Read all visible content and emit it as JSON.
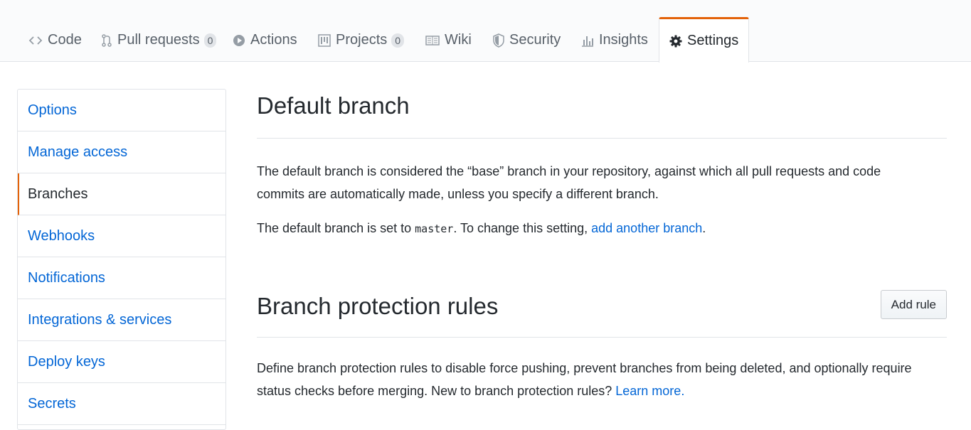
{
  "tabs": [
    {
      "label": "Code",
      "icon": "code-icon"
    },
    {
      "label": "Pull requests",
      "count": "0",
      "icon": "pull-request-icon"
    },
    {
      "label": "Actions",
      "icon": "play-icon"
    },
    {
      "label": "Projects",
      "count": "0",
      "icon": "project-icon"
    },
    {
      "label": "Wiki",
      "icon": "book-icon"
    },
    {
      "label": "Security",
      "icon": "shield-icon"
    },
    {
      "label": "Insights",
      "icon": "graph-icon"
    },
    {
      "label": "Settings",
      "icon": "gear-icon",
      "selected": true
    }
  ],
  "sidebar": {
    "items": [
      {
        "label": "Options"
      },
      {
        "label": "Manage access"
      },
      {
        "label": "Branches",
        "selected": true
      },
      {
        "label": "Webhooks"
      },
      {
        "label": "Notifications"
      },
      {
        "label": "Integrations & services"
      },
      {
        "label": "Deploy keys"
      },
      {
        "label": "Secrets"
      }
    ]
  },
  "default_branch": {
    "title": "Default branch",
    "description": "The default branch is considered the “base” branch in your repository, against which all pull requests and code commits are automatically made, unless you specify a different branch.",
    "set_prefix": "The default branch is set to ",
    "branch_name": "master",
    "set_middle": ". To change this setting, ",
    "set_link": "add another branch",
    "set_suffix": "."
  },
  "protection": {
    "title": "Branch protection rules",
    "add_rule_label": "Add rule",
    "description": "Define branch protection rules to disable force pushing, prevent branches from being deleted, and optionally require status checks before merging. New to branch protection rules? ",
    "learn_more": "Learn more."
  },
  "colors": {
    "accent": "#e36209",
    "link": "#0366d6",
    "text": "#24292e",
    "muted": "#586069",
    "border": "#e1e4e8"
  }
}
